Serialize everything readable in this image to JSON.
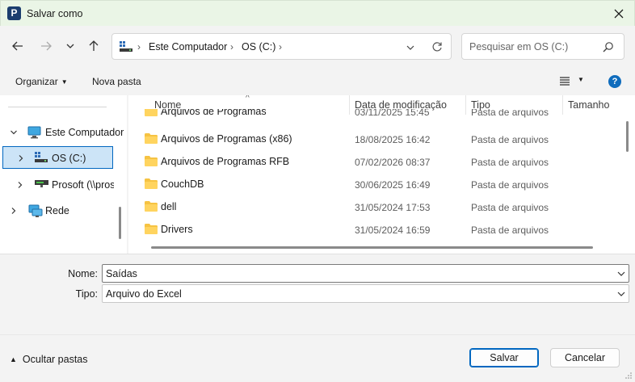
{
  "window": {
    "title": "Salvar como",
    "app_icon_letter": "P"
  },
  "address": {
    "crumbs": [
      "Este Computador",
      "OS (C:)"
    ],
    "separator": "›"
  },
  "search": {
    "placeholder": "Pesquisar em OS (C:)"
  },
  "toolbar": {
    "organize_label": "Organizar",
    "new_folder_label": "Nova pasta",
    "help_label": "?"
  },
  "nav_tree": {
    "items": [
      {
        "label": "Este Computador",
        "icon": "pc-icon"
      },
      {
        "label": "OS (C:)",
        "icon": "drive-icon",
        "selected": true
      },
      {
        "label": "Prosoft (\\\\prosoft)",
        "icon": "network-drive-icon"
      },
      {
        "label": "Rede",
        "icon": "network-icon"
      }
    ]
  },
  "columns": {
    "name": "Nome",
    "date": "Data de modificação",
    "type": "Tipo",
    "size": "Tamanho"
  },
  "files": [
    {
      "name": "Arquivos de Programas",
      "date": "03/11/2025 15:45",
      "type": "Pasta de arquivos"
    },
    {
      "name": "Arquivos de Programas (x86)",
      "date": "18/08/2025 16:42",
      "type": "Pasta de arquivos"
    },
    {
      "name": "Arquivos de Programas RFB",
      "date": "07/02/2026 08:37",
      "type": "Pasta de arquivos"
    },
    {
      "name": "CouchDB",
      "date": "30/06/2025 16:49",
      "type": "Pasta de arquivos"
    },
    {
      "name": "dell",
      "date": "31/05/2024 17:53",
      "type": "Pasta de arquivos"
    },
    {
      "name": "Drivers",
      "date": "31/05/2024 16:59",
      "type": "Pasta de arquivos"
    }
  ],
  "form": {
    "name_label": "Nome:",
    "name_value": "Saídas",
    "type_label": "Tipo:",
    "type_value": "Arquivo do Excel"
  },
  "footer": {
    "hide_folders_label": "Ocultar pastas",
    "save_label": "Salvar",
    "cancel_label": "Cancelar"
  },
  "colors": {
    "title_bg": "#eaf5e6",
    "accent": "#0067c0",
    "selection": "#cce4f7",
    "folder": "#f6c343"
  }
}
